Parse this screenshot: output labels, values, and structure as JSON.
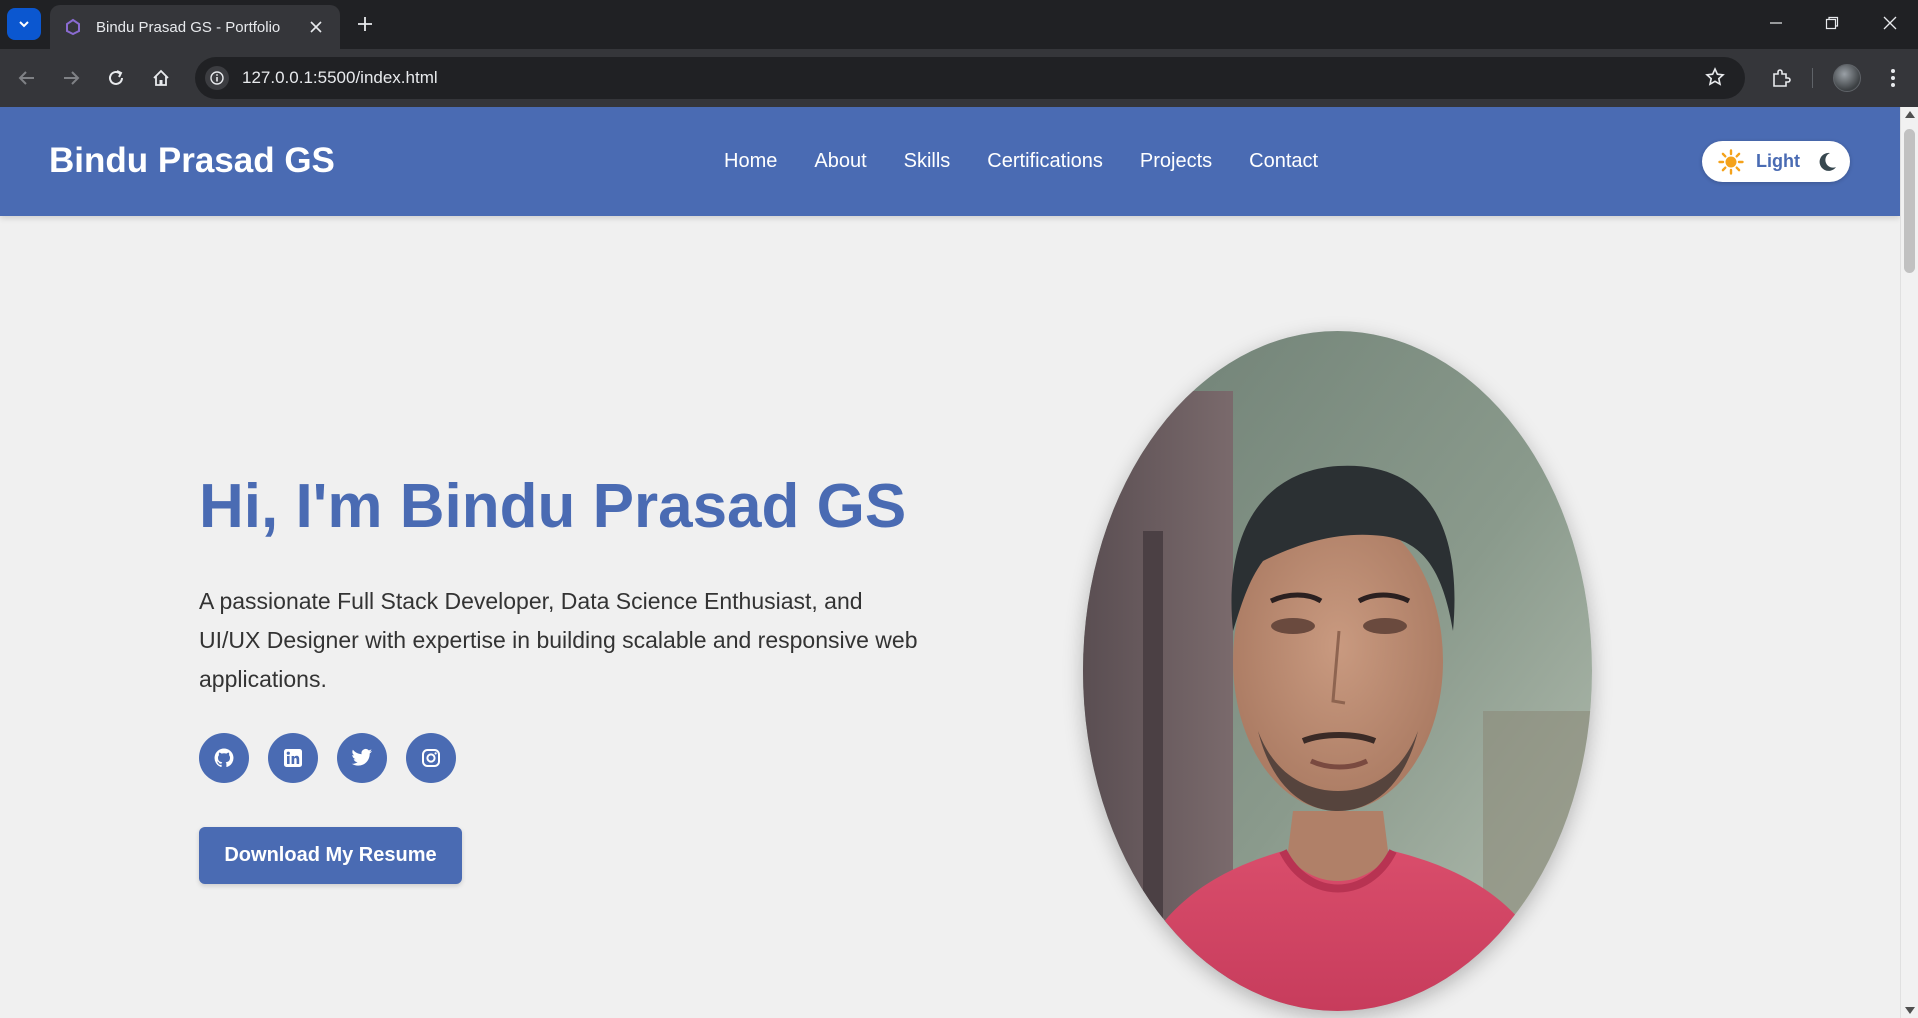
{
  "browser": {
    "tab_title": "Bindu Prasad GS - Portfolio",
    "url": "127.0.0.1:5500/index.html"
  },
  "site": {
    "brand": "Bindu Prasad GS",
    "nav": [
      "Home",
      "About",
      "Skills",
      "Certifications",
      "Projects",
      "Contact"
    ],
    "theme_toggle_label": "Light",
    "accent_color": "#4a6bb3"
  },
  "hero": {
    "title": "Hi, I'm Bindu Prasad GS",
    "description": "A passionate Full Stack Developer, Data Science Enthusiast, and UI/UX Designer with expertise in building scalable and responsive web applications.",
    "socials": [
      "github-icon",
      "linkedin-icon",
      "twitter-icon",
      "instagram-icon"
    ],
    "resume_button": "Download My Resume"
  }
}
